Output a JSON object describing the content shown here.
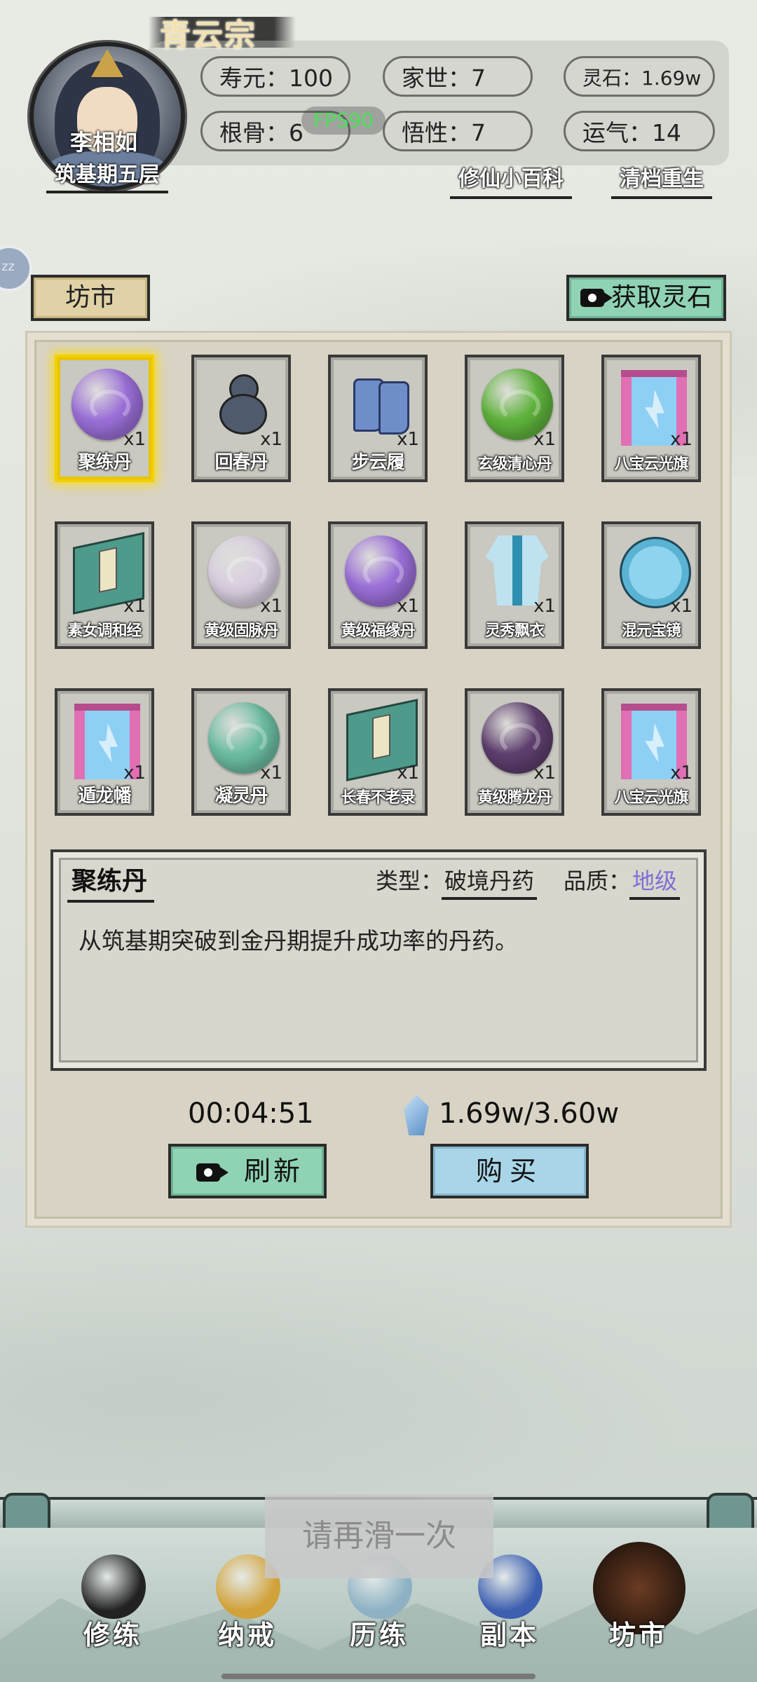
{
  "header": {
    "sect": "青云宗",
    "player_name": "李相如",
    "realm": "筑基期五层",
    "fps": "FPS90",
    "stats": [
      {
        "label": "寿元：100"
      },
      {
        "label": "家世：7"
      },
      {
        "label": "灵石：1.69w"
      },
      {
        "label": "根骨：6"
      },
      {
        "label": "悟性：7"
      },
      {
        "label": "运气：14"
      }
    ],
    "links": {
      "wiki": "修仙小百科",
      "reset": "清档重生"
    },
    "side_tab": "zz"
  },
  "market": {
    "title": "坊市",
    "get_stone": "获取灵石",
    "items": [
      {
        "name": "聚练丹",
        "qty": "x1",
        "icon": "purple-pill-icon",
        "color": "#9b6fd8",
        "selected": true
      },
      {
        "name": "回春丹",
        "qty": "x1",
        "icon": "gourd-icon"
      },
      {
        "name": "步云履",
        "qty": "x1",
        "icon": "boots-icon"
      },
      {
        "name": "玄级清心丹",
        "qty": "x1",
        "icon": "green-pill-icon",
        "color": "#5fb33d"
      },
      {
        "name": "八宝云光旗",
        "qty": "x1",
        "icon": "banner-icon"
      },
      {
        "name": "素女调和经",
        "qty": "x1",
        "icon": "book-icon"
      },
      {
        "name": "黄级固脉丹",
        "qty": "x1",
        "icon": "white-pill-icon",
        "color": "#d9cfe0"
      },
      {
        "name": "黄级福缘丹",
        "qty": "x1",
        "icon": "purple-pill-icon",
        "color": "#9b6fd8"
      },
      {
        "name": "灵秀飘衣",
        "qty": "x1",
        "icon": "robe-icon"
      },
      {
        "name": "混元宝镜",
        "qty": "x1",
        "icon": "mirror-icon"
      },
      {
        "name": "遁龙幡",
        "qty": "x1",
        "icon": "banner-icon"
      },
      {
        "name": "凝灵丹",
        "qty": "x1",
        "icon": "teal-pill-icon",
        "color": "#6cbda3"
      },
      {
        "name": "长春不老录",
        "qty": "x1",
        "icon": "book-icon"
      },
      {
        "name": "黄级腾龙丹",
        "qty": "x1",
        "icon": "dark-purple-pill-icon",
        "color": "#5e3f6e"
      },
      {
        "name": "八宝云光旗",
        "qty": "x1",
        "icon": "banner-icon"
      }
    ],
    "detail": {
      "name": "聚练丹",
      "type_label": "类型：",
      "type_value": "破境丹药",
      "quality_label": "品质：",
      "quality_value": "地级",
      "quality_color": "#7f6fd6",
      "description": "从筑基期突破到金丹期提升成功率的丹药。"
    },
    "timer": "00:04:51",
    "stones": "1.69w/3.60w",
    "refresh": "刷新",
    "buy": "购买"
  },
  "toast": "请再滑一次",
  "nav": [
    {
      "label": "修练",
      "icon": "yinyang-icon"
    },
    {
      "label": "纳戒",
      "icon": "ring-icon"
    },
    {
      "label": "历练",
      "icon": "mountain-cloud-icon"
    },
    {
      "label": "副本",
      "icon": "pagoda-icon"
    },
    {
      "label": "坊市",
      "icon": "cauldron-icon",
      "active": true
    }
  ]
}
